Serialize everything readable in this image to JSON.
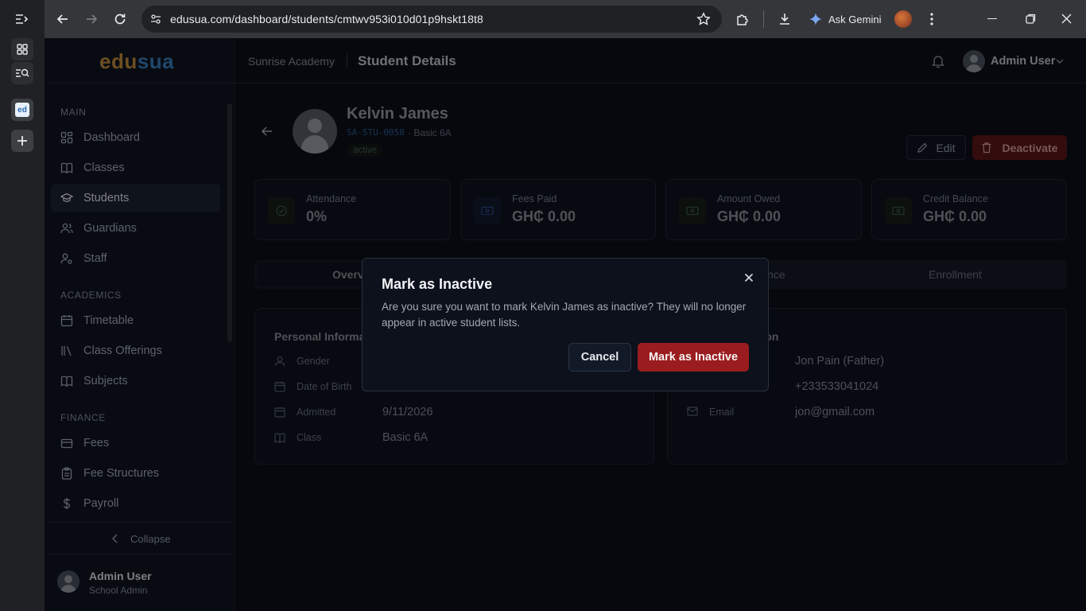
{
  "browser": {
    "url": "edusua.com/dashboard/students/cmtwv953i010d01p9hskt18t8",
    "ask_gemini": "Ask Gemini"
  },
  "logo": {
    "part1": "edu",
    "part2": "sua"
  },
  "sidebar": {
    "sections": {
      "main": "MAIN",
      "academics": "ACADEMICS",
      "finance": "FINANCE"
    },
    "items": [
      {
        "label": "Dashboard",
        "icon": "dashboard-icon"
      },
      {
        "label": "Classes",
        "icon": "book-icon"
      },
      {
        "label": "Students",
        "icon": "graduation-cap-icon"
      },
      {
        "label": "Guardians",
        "icon": "users-icon"
      },
      {
        "label": "Staff",
        "icon": "user-cog-icon"
      },
      {
        "label": "Timetable",
        "icon": "calendar-icon"
      },
      {
        "label": "Class Offerings",
        "icon": "library-icon"
      },
      {
        "label": "Subjects",
        "icon": "book-open-icon"
      },
      {
        "label": "Fees",
        "icon": "wallet-icon"
      },
      {
        "label": "Fee Structures",
        "icon": "clipboard-icon"
      },
      {
        "label": "Payroll",
        "icon": "dollar-icon"
      }
    ],
    "collapse": "Collapse",
    "user": {
      "name": "Admin User",
      "role": "School Admin"
    }
  },
  "topbar": {
    "school": "Sunrise Academy",
    "page": "Student Details",
    "user": "Admin User"
  },
  "student": {
    "name": "Kelvin James",
    "id": "SA-STU-0058",
    "class_meta": "· Basic 6A",
    "status": "active",
    "edit": "Edit",
    "deactivate": "Deactivate"
  },
  "stats": [
    {
      "label": "Attendance",
      "value": "0%"
    },
    {
      "label": "Fees Paid",
      "value": "GH₵ 0.00"
    },
    {
      "label": "Amount Owed",
      "value": "GH₵ 0.00"
    },
    {
      "label": "Credit Balance",
      "value": "GH₵ 0.00"
    }
  ],
  "tabs": {
    "overview": "Overv",
    "attendance": "nce",
    "enrollment": "Enrollment"
  },
  "personal": {
    "title": "Personal Informat",
    "rows": [
      {
        "label": "Gender",
        "value": ""
      },
      {
        "label": "Date of Birth",
        "value": ""
      },
      {
        "label": "Admitted",
        "value": "9/11/2026"
      },
      {
        "label": "Class",
        "value": "Basic 6A"
      }
    ]
  },
  "guardian": {
    "title": "ation",
    "rows": [
      {
        "label": "",
        "value": "Jon Pain (Father)"
      },
      {
        "label": "",
        "value": "+233533041024"
      },
      {
        "label": "Email",
        "value": "jon@gmail.com"
      }
    ]
  },
  "modal": {
    "title": "Mark as Inactive",
    "message": "Are you sure you want to mark Kelvin James as inactive? They will no longer appear in active student lists.",
    "cancel": "Cancel",
    "confirm": "Mark as Inactive"
  }
}
